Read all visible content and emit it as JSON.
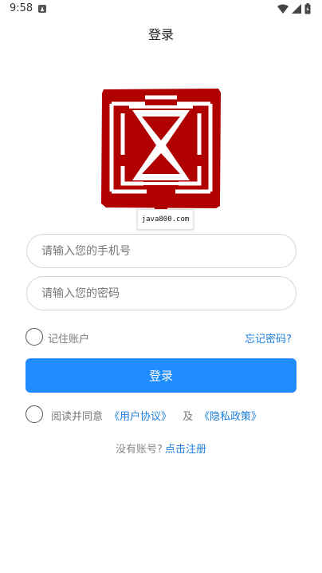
{
  "status_bar": {
    "time": "9:58",
    "notification_icon": "notification-icon",
    "icons": [
      "wifi-icon",
      "signal-icon",
      "battery-icon"
    ]
  },
  "header": {
    "title": "登录"
  },
  "logo": {
    "icon": "hourglass-seal-logo",
    "caption": "java800.com",
    "color": "#b00000"
  },
  "form": {
    "phone_placeholder": "请输入您的手机号",
    "phone_value": "",
    "password_placeholder": "请输入您的密码",
    "password_value": "",
    "remember_label": "记住账户",
    "forgot_label": "忘记密码?",
    "login_label": "登录"
  },
  "agreement": {
    "prefix": "阅读并同意",
    "user_agreement": "《用户协议》",
    "and": "及",
    "privacy_policy": "《隐私政策》"
  },
  "register": {
    "prompt": "没有账号?",
    "link": "点击注册"
  },
  "colors": {
    "accent": "#1e8bff",
    "link": "#1e7fe0"
  }
}
